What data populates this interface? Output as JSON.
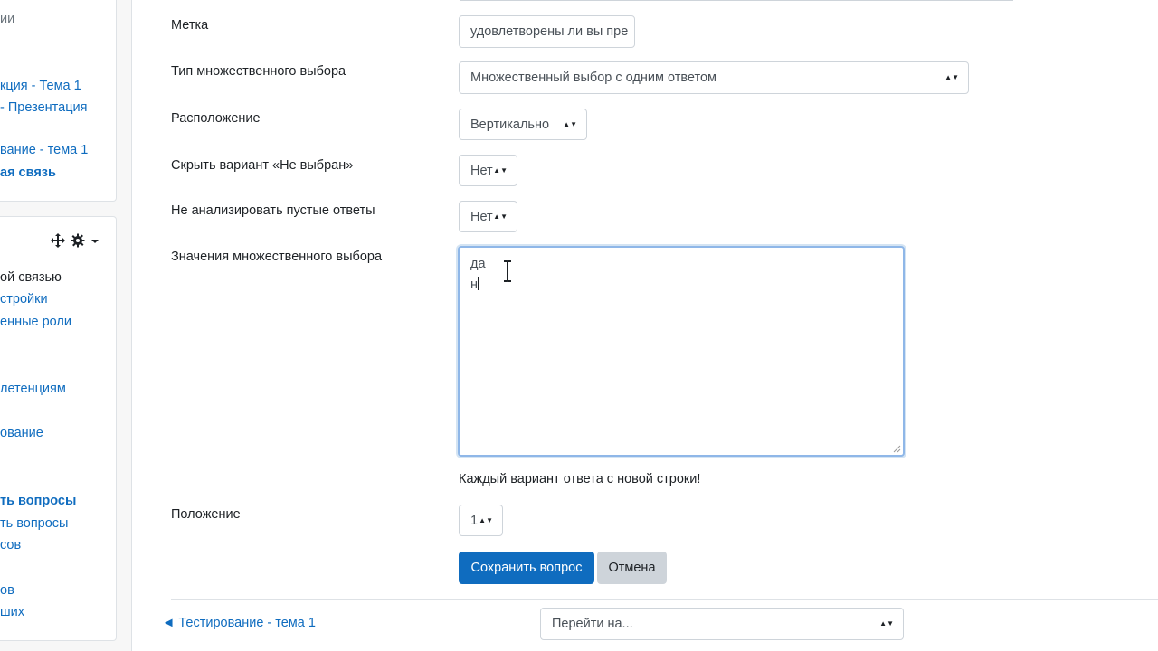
{
  "sidebar": {
    "block1_items": [
      "ии",
      "кция - Тема 1",
      "- Презентация",
      "вание - тема 1",
      "ая связь"
    ],
    "block2_items": [
      "ой связью",
      "стройки",
      "енные роли",
      ")",
      "летенциям",
      "ование",
      "ть вопросы",
      "ть вопросы",
      "сов",
      "ов",
      "ших"
    ]
  },
  "form": {
    "label_field": {
      "label": "Метка",
      "value": "удовлетворены ли вы пре"
    },
    "type_field": {
      "label": "Тип множественного выбора",
      "value": "Множественный выбор с одним ответом"
    },
    "layout_field": {
      "label": "Расположение",
      "value": "Вертикально"
    },
    "hide_field": {
      "label": "Скрыть вариант «Не выбран»",
      "value": "Нет"
    },
    "empty_field": {
      "label": "Не анализировать пустые ответы",
      "value": "Нет"
    },
    "values_field": {
      "label": "Значения множественного выбора",
      "lines": [
        "да",
        "н"
      ]
    },
    "hint": "Каждый вариант ответа с новой строки!",
    "position_field": {
      "label": "Положение",
      "value": "1"
    },
    "save_label": "Сохранить вопрос",
    "cancel_label": "Отмена"
  },
  "footer": {
    "prev_link": "◄ Тестирование - тема 1",
    "jump_placeholder": "Перейти на..."
  },
  "colors": {
    "link": "#0f6cbf",
    "primary": "#0f6cbf",
    "focus_border": "#8fb7e8"
  }
}
